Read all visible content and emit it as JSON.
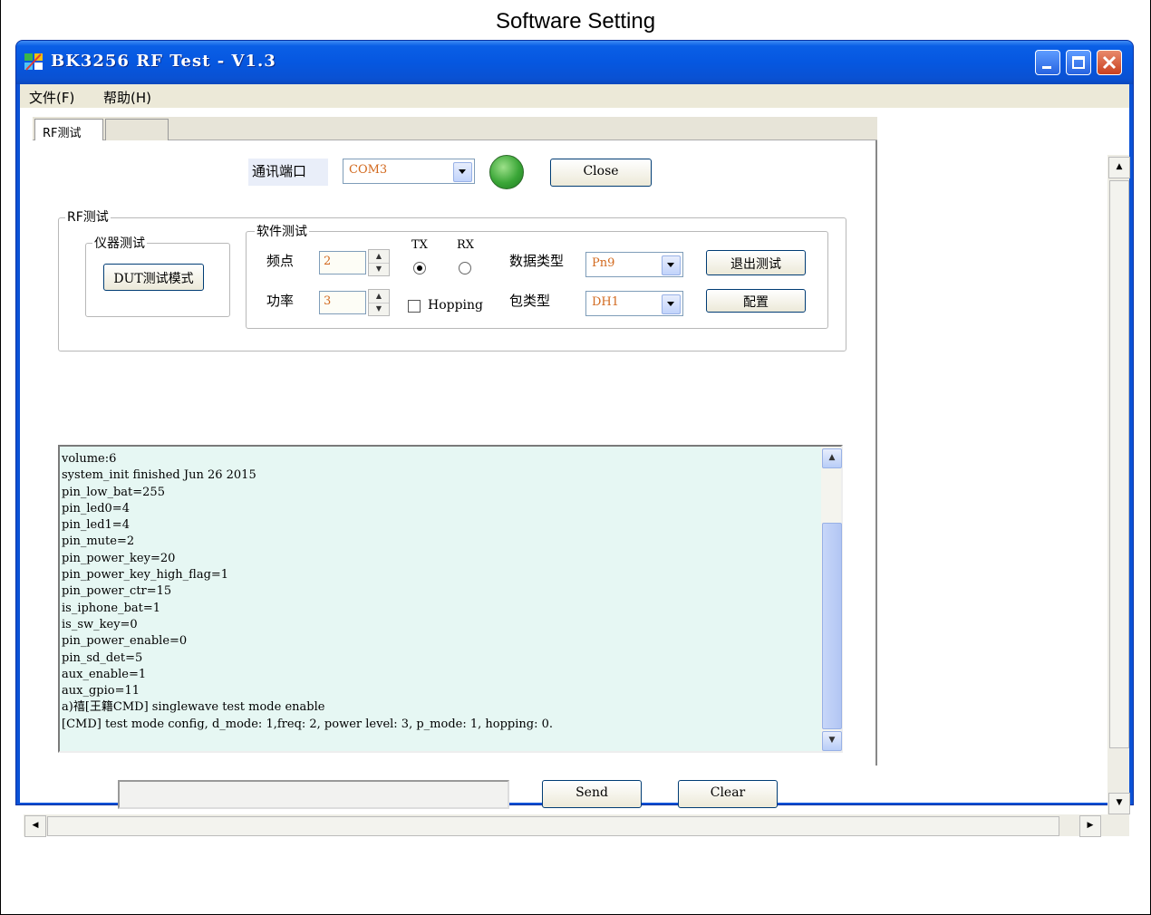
{
  "caption": "Software Setting",
  "window": {
    "title": "BK3256 RF Test - V1.3",
    "controls": {
      "minimize_icon": "minimize-icon",
      "maximize_icon": "maximize-icon",
      "close_icon": "close-icon"
    }
  },
  "menu": {
    "file": "文件(F)",
    "help": "帮助(H)"
  },
  "tabs": [
    {
      "label": "RF测试"
    },
    {
      "label": ""
    }
  ],
  "connection": {
    "port_label": "通讯端口",
    "port_value": "COM3",
    "status_color": "#3aa637",
    "close_button": "Close"
  },
  "rf_group": {
    "title": "RF测试",
    "instrument": {
      "title": "仪器测试",
      "dut_button": "DUT测试模式"
    },
    "software": {
      "title": "软件测试",
      "freq_label": "频点",
      "freq_value": "2",
      "power_label": "功率",
      "power_value": "3",
      "tx_label": "TX",
      "rx_label": "RX",
      "tx_selected": true,
      "hopping_label": "Hopping",
      "hopping_checked": false,
      "data_type_label": "数据类型",
      "data_type_value": "Pn9",
      "packet_type_label": "包类型",
      "packet_type_value": "DH1",
      "exit_button": "退出测试",
      "config_button": "配置"
    }
  },
  "log": {
    "lines": [
      "volume:6",
      "system_init finished Jun 26 2015",
      "pin_low_bat=255",
      "pin_led0=4",
      "pin_led1=4",
      "pin_mute=2",
      "pin_power_key=20",
      "pin_power_key_high_flag=1",
      "pin_power_ctr=15",
      "is_iphone_bat=1",
      "is_sw_key=0",
      "pin_power_enable=0",
      "pin_sd_det=5",
      "aux_enable=1",
      "aux_gpio=11",
      "a)禧[王籍CMD] singlewave test mode enable",
      "[CMD] test mode config, d_mode: 1,freq: 2, power level: 3, p_mode: 1, hopping: 0."
    ]
  },
  "send": {
    "input_value": "",
    "send_button": "Send",
    "clear_button": "Clear"
  }
}
